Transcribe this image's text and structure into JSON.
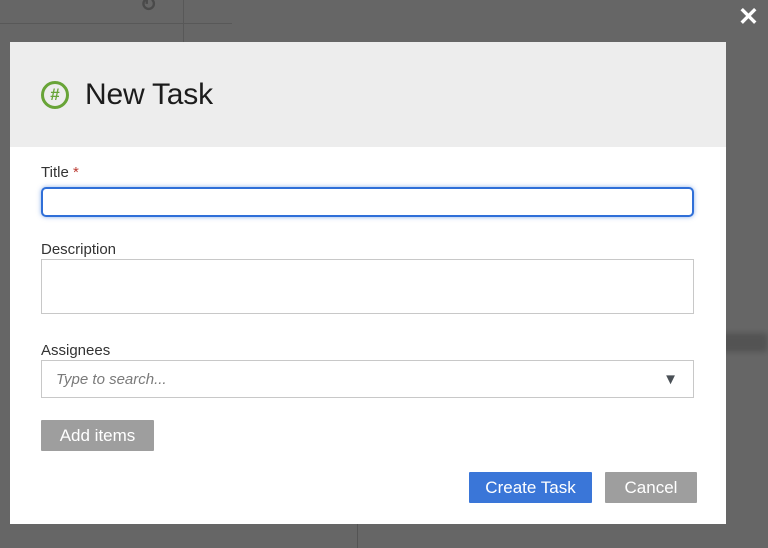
{
  "overlay": {
    "close_icon": "✕",
    "background_refresh_icon": "↻"
  },
  "dialog": {
    "title": "New Task",
    "icon_glyph": "#",
    "fields": {
      "title": {
        "label": "Title",
        "required_marker": "*",
        "value": ""
      },
      "description": {
        "label": "Description",
        "value": ""
      },
      "assignees": {
        "label": "Assignees",
        "placeholder": "Type to search...",
        "value": "",
        "dropdown_icon": "▼",
        "add_items_label": "Add items"
      }
    },
    "actions": {
      "create_label": "Create Task",
      "cancel_label": "Cancel"
    }
  },
  "colors": {
    "accent_blue": "#3a76d8",
    "focus_border_blue": "#2f6fd8",
    "icon_green": "#68a437",
    "button_gray": "#9e9e9e",
    "header_bg": "#ededed",
    "required_red": "#bb3a31",
    "overlay": "rgba(0,0,0,0.6)"
  }
}
